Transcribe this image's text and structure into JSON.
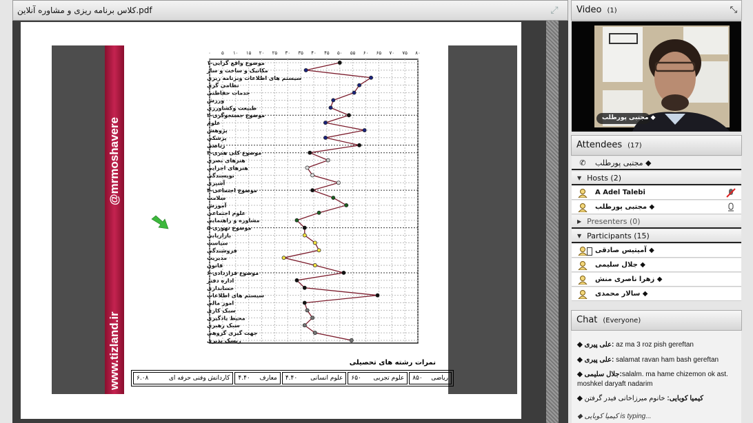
{
  "document_pod": {
    "title": "کلاس برنامه ریزی و مشاوره آنلاین.pdf",
    "expand_icon": "fullscreen-icon"
  },
  "slide": {
    "watermark_top": "@mrmoshavere",
    "watermark_bottom": "www.tizland.ir",
    "arrow_color": "#3cb83c",
    "scores_title": "نمرات رشته های تحصیلی",
    "scores": [
      {
        "field": "ریاضی",
        "value": "۸۵۰"
      },
      {
        "field": "علوم تجربی",
        "value": "۶۵۰"
      },
      {
        "field": "علوم انسانی",
        "value": "۴.۴۰"
      },
      {
        "field": "معارف",
        "value": "۴.۴۰"
      },
      {
        "field": "کاردانش وفنی حرفه ای",
        "value": "۶.۰۸"
      }
    ]
  },
  "chart_data": {
    "type": "line",
    "orientation": "horizontal",
    "xlim": [
      0,
      80
    ],
    "x_ticks": [
      "۰",
      "۵",
      "۱۰",
      "۱۵",
      "۲۰",
      "۲۵",
      "۳۰",
      "۳۵",
      "۴۰",
      "۴۵",
      "۵۰",
      "۵۵",
      "۶۰",
      "۶۵",
      "۷۰",
      "۷۵",
      "۸۰"
    ],
    "grid": true,
    "line_color": "#7a1a2a",
    "categories": [
      "موضوع واقع گرایی-۱",
      "مکانیک و ساخت و ساز",
      "سیستم های اطلاعات وبرنامه ریزی",
      "نظامی گری",
      "خدمات حفاظتی",
      "ورزش",
      "طبیعت وکشاورزی",
      "موضوع جستجوگری-۲",
      "علوم",
      "پژوهش",
      "پزشکی",
      "ریاضی",
      "موضوع کلی هنری-۳",
      "هنرهای بصری",
      "هنرهای اجرایی",
      "نویسندگی",
      "آشپزی",
      "موضوع اجتماعی-۴",
      "سلامت",
      "آموزش",
      "علوم اجتماعی",
      "مشاوره و راهنمایی",
      "موضوع تهوری-۵",
      "بازاریابی",
      "سیاست",
      "فروشندگی",
      "مدیریت",
      "قانون",
      "موضوع قراردادی-۶",
      "اداره دفتر",
      "حسابداری",
      "سیستم های اطلاعات",
      "امور مالی",
      "سبک کاری",
      "محیط یادگیری",
      "سبک رهبری",
      "جهت گیری گروهی",
      "ریسک پذیری"
    ],
    "values": [
      50,
      37,
      62,
      57.5,
      55.5,
      47.5,
      46.5,
      53.5,
      44.5,
      59.5,
      44.5,
      57.5,
      38.5,
      45.5,
      37.5,
      39.5,
      49.5,
      39.5,
      47.5,
      52.5,
      42,
      33.5,
      36.5,
      36.5,
      40.5,
      42,
      28.5,
      40.5,
      51.5,
      33.5,
      36.5,
      64.5,
      36.5,
      37.5,
      39.5,
      36.5,
      40.5,
      54.5
    ],
    "marker_colors": [
      "#111",
      "#1a237e",
      "#1a237e",
      "#1a237e",
      "#1a237e",
      "#1a237e",
      "#1a237e",
      "#111",
      "#1a237e",
      "#1a237e",
      "#1a237e",
      "#111",
      "#111",
      "#ccc",
      "#ddd",
      "#ddd",
      "#ddd",
      "#111",
      "#1b5e20",
      "#1b5e20",
      "#1b5e20",
      "#1b5e20",
      "#111",
      "#f5e342",
      "#f5e342",
      "#f5e342",
      "#f5e342",
      "#f5e342",
      "#111",
      "#111",
      "#111",
      "#111",
      "#111",
      "#777",
      "#777",
      "#777",
      "#777",
      "#777"
    ]
  },
  "video": {
    "title": "Video",
    "count": "(1)",
    "speaker_label": "مجتبی پورطلب ◆",
    "logo": "تیزلند",
    "expand_icon": "fullscreen-icon"
  },
  "attendees": {
    "title": "Attendees",
    "count": "(17)",
    "presenter": "مجتبی پورطلب ◆",
    "groups": [
      {
        "label": "Hosts (2)",
        "expanded": true,
        "members": [
          {
            "name": "A Adel Talebi",
            "status_icon": "mic-muted-icon"
          },
          {
            "name": "مجتبی پورطلب ◆",
            "status_icon": "mic-active-icon"
          }
        ]
      },
      {
        "label": "Presenters (0)",
        "expanded": false,
        "members": []
      },
      {
        "label": "Participants (15)",
        "expanded": true,
        "members": [
          {
            "name": "آمیتیس صادقی ◆",
            "status_icon": "mobile-icon"
          },
          {
            "name": "جلال سلیمی ◆"
          },
          {
            "name": "زهرا ناصری منش ◆"
          },
          {
            "name": "سالار محمدی ◆"
          }
        ]
      }
    ]
  },
  "chat": {
    "title": "Chat",
    "scope": "(Everyone)",
    "messages": [
      {
        "sender": "◆ علی پیری:",
        "text": " az ma 3 roz pish gereftan"
      },
      {
        "sender": "◆ علی پیری:",
        "text": " salamat ravan ham bash gereftan"
      },
      {
        "sender": "◆ جلال سلیمی:",
        "text": "salalm. ma hame chizemon ok ast. moshkel daryaft nadarim"
      },
      {
        "sender": "◆ کیمیا کوبایی:",
        "text": " خانوم میرزاخانی فیدر گرفتن"
      }
    ],
    "typing": "◆ کیمیا کوبایی is typing..."
  }
}
